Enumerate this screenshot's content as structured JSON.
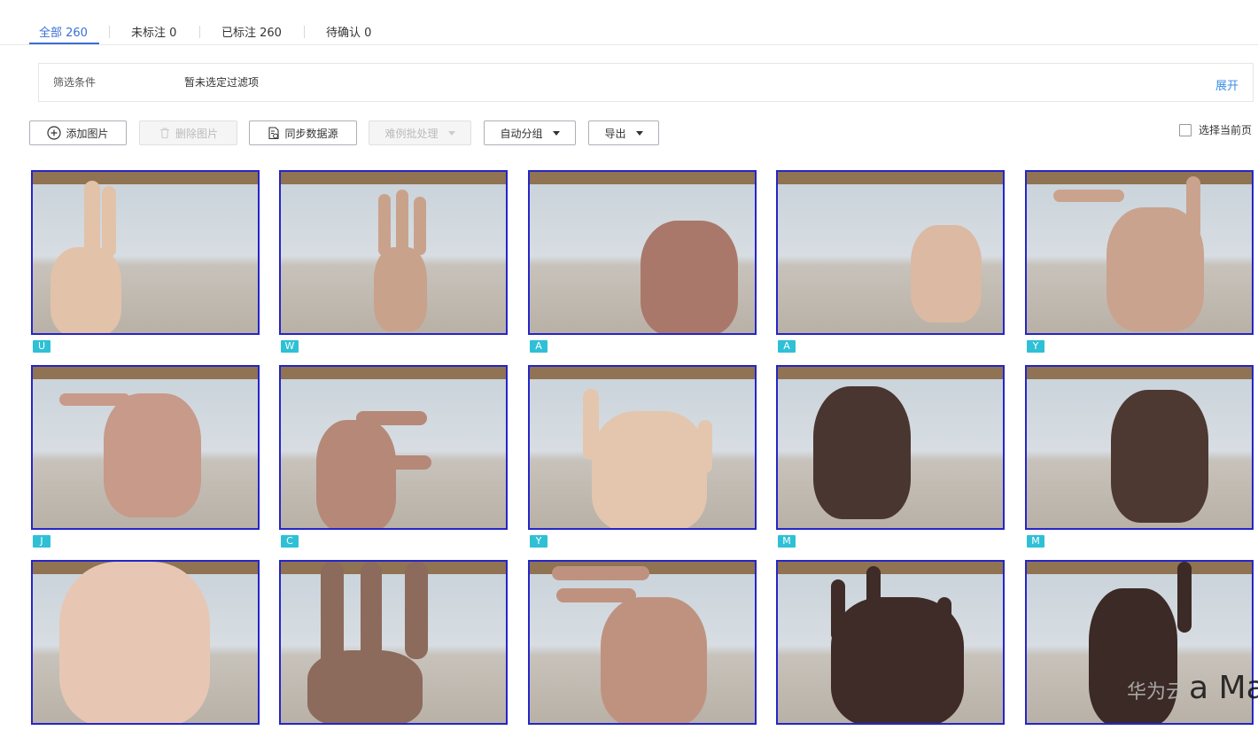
{
  "tabs": [
    {
      "label": "全部 260",
      "active": true
    },
    {
      "label": "未标注 0",
      "active": false
    },
    {
      "label": "已标注 260",
      "active": false
    },
    {
      "label": "待确认 0",
      "active": false
    }
  ],
  "filter": {
    "label": "筛选条件",
    "value": "暂未选定过滤项",
    "expand": "展开"
  },
  "toolbar": {
    "add": "添加图片",
    "delete": "删除图片",
    "sync": "同步数据源",
    "hard_case": "难例批处理",
    "auto_group": "自动分组",
    "export": "导出",
    "select_page": "选择当前页"
  },
  "images": [
    {
      "label": "U",
      "skin": "#e2c2a8"
    },
    {
      "label": "W",
      "skin": "#c9a28c"
    },
    {
      "label": "A",
      "skin": "#a9786a"
    },
    {
      "label": "A",
      "skin": "#dcb9a3"
    },
    {
      "label": "Y",
      "skin": "#c9a38e"
    },
    {
      "label": "J",
      "skin": "#c79a8a"
    },
    {
      "label": "C",
      "skin": "#b58878"
    },
    {
      "label": "Y",
      "skin": "#e4c6ae"
    },
    {
      "label": "M",
      "skin": "#4a3630"
    },
    {
      "label": "M",
      "skin": "#4d3932"
    },
    {
      "label": "",
      "skin": "#e7c7b4"
    },
    {
      "label": "",
      "skin": "#8c6a5c"
    },
    {
      "label": "",
      "skin": "#bf9280"
    },
    {
      "label": "",
      "skin": "#3f2c28"
    },
    {
      "label": "",
      "skin": "#3b2a26"
    }
  ],
  "watermark": {
    "brand": "华为云",
    "text": "a Made"
  },
  "colors": {
    "accent": "#3a6ed8",
    "tag": "#2fc0d6",
    "thumb_border": "#2525c8"
  }
}
